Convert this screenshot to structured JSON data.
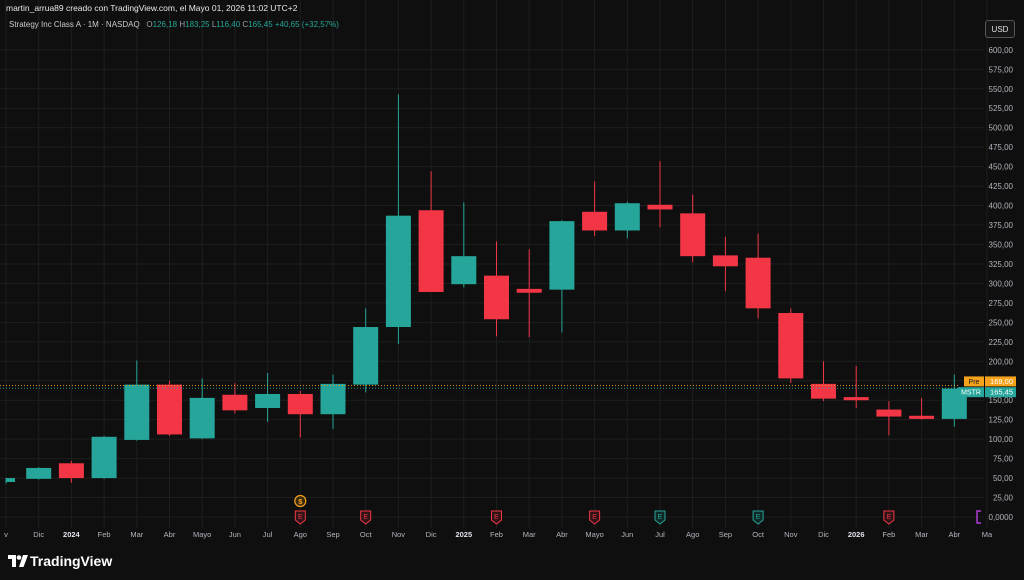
{
  "header": {
    "credit": "martin_arrua89 creado con TradingView.com, el Mayo 01, 2026 11:02 UTC+2",
    "symbol": "Strategy Inc Class A · 1M · NASDAQ",
    "o_label": "O",
    "o_val": "126,18",
    "h_label": "H",
    "h_val": "183,25",
    "l_label": "L",
    "l_val": "116,40",
    "c_label": "C",
    "c_val": "165,45",
    "change": "+40,65 (+32,57%)"
  },
  "currency": "USD",
  "brand": "TradingView",
  "colors": {
    "up": "#26a69a",
    "down": "#f23645",
    "pre": "#f7a21b",
    "grid": "#1e1e1e",
    "axis_text": "#b2b5be"
  },
  "chart_data": {
    "type": "candlestick",
    "ylim": [
      0,
      620
    ],
    "y_ticks": [
      0,
      25,
      50,
      75,
      100,
      125,
      150,
      175,
      200,
      225,
      250,
      275,
      300,
      325,
      350,
      375,
      400,
      425,
      450,
      475,
      500,
      525,
      550,
      575,
      600
    ],
    "y_tick_labels": [
      "0,0000",
      "25,00",
      "50,00",
      "75,00",
      "100,00",
      "125,00",
      "150,00",
      "175,00",
      "200,00",
      "225,00",
      "250,00",
      "275,00",
      "300,00",
      "325,00",
      "350,00",
      "375,00",
      "400,00",
      "425,00",
      "450,00",
      "475,00",
      "500,00",
      "525,00",
      "550,00",
      "575,00",
      "600,00"
    ],
    "x_labels": [
      "v",
      "Dic",
      "2024",
      "Feb",
      "Mar",
      "Abr",
      "Mayo",
      "Jun",
      "Jul",
      "Ago",
      "Sep",
      "Oct",
      "Nov",
      "Dic",
      "2025",
      "Feb",
      "Mar",
      "Abr",
      "Mayo",
      "Jun",
      "Jul",
      "Ago",
      "Sep",
      "Oct",
      "Nov",
      "Dic",
      "2026",
      "Feb",
      "Mar",
      "Abr",
      "Ma"
    ],
    "candles": [
      {
        "o": 45,
        "h": 50,
        "l": 43,
        "c": 50
      },
      {
        "o": 49,
        "h": 64,
        "l": 48,
        "c": 63
      },
      {
        "o": 69,
        "h": 72,
        "l": 44,
        "c": 50
      },
      {
        "o": 50,
        "h": 104,
        "l": 49,
        "c": 103
      },
      {
        "o": 99,
        "h": 201,
        "l": 98,
        "c": 170
      },
      {
        "o": 170,
        "h": 175,
        "l": 104,
        "c": 106
      },
      {
        "o": 101,
        "h": 178,
        "l": 100,
        "c": 153
      },
      {
        "o": 157,
        "h": 172,
        "l": 133,
        "c": 137
      },
      {
        "o": 140,
        "h": 185,
        "l": 122,
        "c": 158
      },
      {
        "o": 158,
        "h": 162,
        "l": 102,
        "c": 132
      },
      {
        "o": 132,
        "h": 183,
        "l": 113,
        "c": 171
      },
      {
        "o": 170,
        "h": 268,
        "l": 160,
        "c": 244
      },
      {
        "o": 244,
        "h": 543,
        "l": 222,
        "c": 387
      },
      {
        "o": 394,
        "h": 444,
        "l": 289,
        "c": 289
      },
      {
        "o": 299,
        "h": 404,
        "l": 295,
        "c": 335
      },
      {
        "o": 310,
        "h": 354,
        "l": 232,
        "c": 254
      },
      {
        "o": 293,
        "h": 344,
        "l": 231,
        "c": 288
      },
      {
        "o": 292,
        "h": 381,
        "l": 237,
        "c": 380
      },
      {
        "o": 392,
        "h": 431,
        "l": 361,
        "c": 368
      },
      {
        "o": 368,
        "h": 405,
        "l": 358,
        "c": 403
      },
      {
        "o": 401,
        "h": 457,
        "l": 372,
        "c": 395
      },
      {
        "o": 390,
        "h": 414,
        "l": 327,
        "c": 335
      },
      {
        "o": 336,
        "h": 360,
        "l": 290,
        "c": 322
      },
      {
        "o": 333,
        "h": 364,
        "l": 255,
        "c": 268
      },
      {
        "o": 262,
        "h": 268,
        "l": 172,
        "c": 178
      },
      {
        "o": 171,
        "h": 200,
        "l": 149,
        "c": 152
      },
      {
        "o": 154,
        "h": 194,
        "l": 140,
        "c": 150
      },
      {
        "o": 138,
        "h": 149,
        "l": 105,
        "c": 129
      },
      {
        "o": 130,
        "h": 153,
        "l": 125,
        "c": 126
      },
      {
        "o": 126,
        "h": 183,
        "l": 116,
        "c": 165
      }
    ],
    "price_lines": [
      {
        "label": "Pre",
        "value_label": "169,00",
        "value": 169
      },
      {
        "label": "MSTR",
        "value_label": "165,45",
        "value": 165.45
      }
    ],
    "events": [
      {
        "index": 9,
        "glyph": "$",
        "kind": "dividend"
      },
      {
        "index": 9,
        "glyph": "E",
        "kind": "earnings-red"
      },
      {
        "index": 11,
        "glyph": "E",
        "kind": "earnings-red"
      },
      {
        "index": 15,
        "glyph": "E",
        "kind": "earnings-red"
      },
      {
        "index": 18,
        "glyph": "E",
        "kind": "earnings-red"
      },
      {
        "index": 20,
        "glyph": "E",
        "kind": "earnings-green"
      },
      {
        "index": 23,
        "glyph": "E",
        "kind": "earnings-green"
      },
      {
        "index": 27,
        "glyph": "E",
        "kind": "earnings-red"
      }
    ]
  }
}
